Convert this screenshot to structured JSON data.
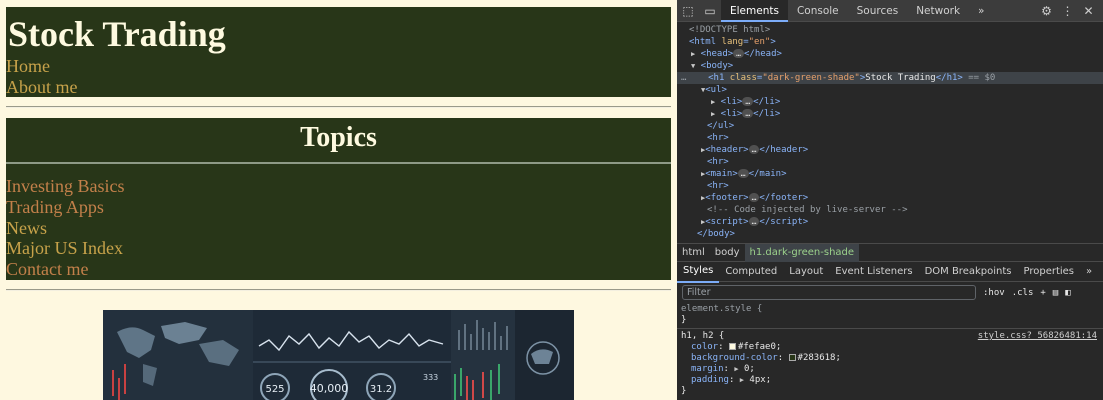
{
  "page": {
    "site_title": "Stock Trading",
    "nav": [
      "Home",
      "About me"
    ],
    "topics_heading": "Topics",
    "topics": [
      "Investing Basics",
      "Trading Apps",
      "News",
      "Major US Index",
      "Contact me"
    ],
    "hero_numbers": [
      "525",
      "40,000",
      "31.2",
      "333"
    ]
  },
  "devtools": {
    "tabs": [
      "Elements",
      "Console",
      "Sources",
      "Network"
    ],
    "more_tabs": "»",
    "tree": {
      "doctype": "<!DOCTYPE html>",
      "html_open": "html",
      "lang_attr": "lang",
      "lang_val": "\"en\"",
      "head": "head",
      "body": "body",
      "h1_attr": "class",
      "h1_attr_val": "\"dark-green-shade\"",
      "h1_text": "Stock Trading",
      "selected_marker": "== $0",
      "ul": "ul",
      "li": "li",
      "hr": "hr",
      "header": "header",
      "main": "main",
      "footer": "footer",
      "comment": "<!-- Code injected by live-server -->",
      "script": "script",
      "ellipsis": "…"
    },
    "breadcrumbs": [
      "html",
      "body",
      "h1.dark-green-shade"
    ],
    "sub_tabs": [
      "Styles",
      "Computed",
      "Layout",
      "Event Listeners",
      "DOM Breakpoints",
      "Properties"
    ],
    "filter_placeholder": "Filter",
    "filter_buttons": [
      ":hov",
      ".cls",
      "+"
    ],
    "styles": {
      "element_style": "element.style {",
      "close_brace": "}",
      "selector": "h1, h2 {",
      "source": "style.css?_56826481:14",
      "props": [
        {
          "name": "color",
          "value": "#fefae0",
          "swatch": "#fefae0"
        },
        {
          "name": "background-color",
          "value": "#283618",
          "swatch": "#283618"
        },
        {
          "name": "margin",
          "value": "0"
        },
        {
          "name": "padding",
          "value": "4px"
        }
      ]
    }
  },
  "colors": {
    "page_bg": "#fef8e0",
    "dark_green": "#283618",
    "cream": "#fefae0",
    "gold_link": "#c7a24a",
    "brown_link": "#c3804a"
  }
}
